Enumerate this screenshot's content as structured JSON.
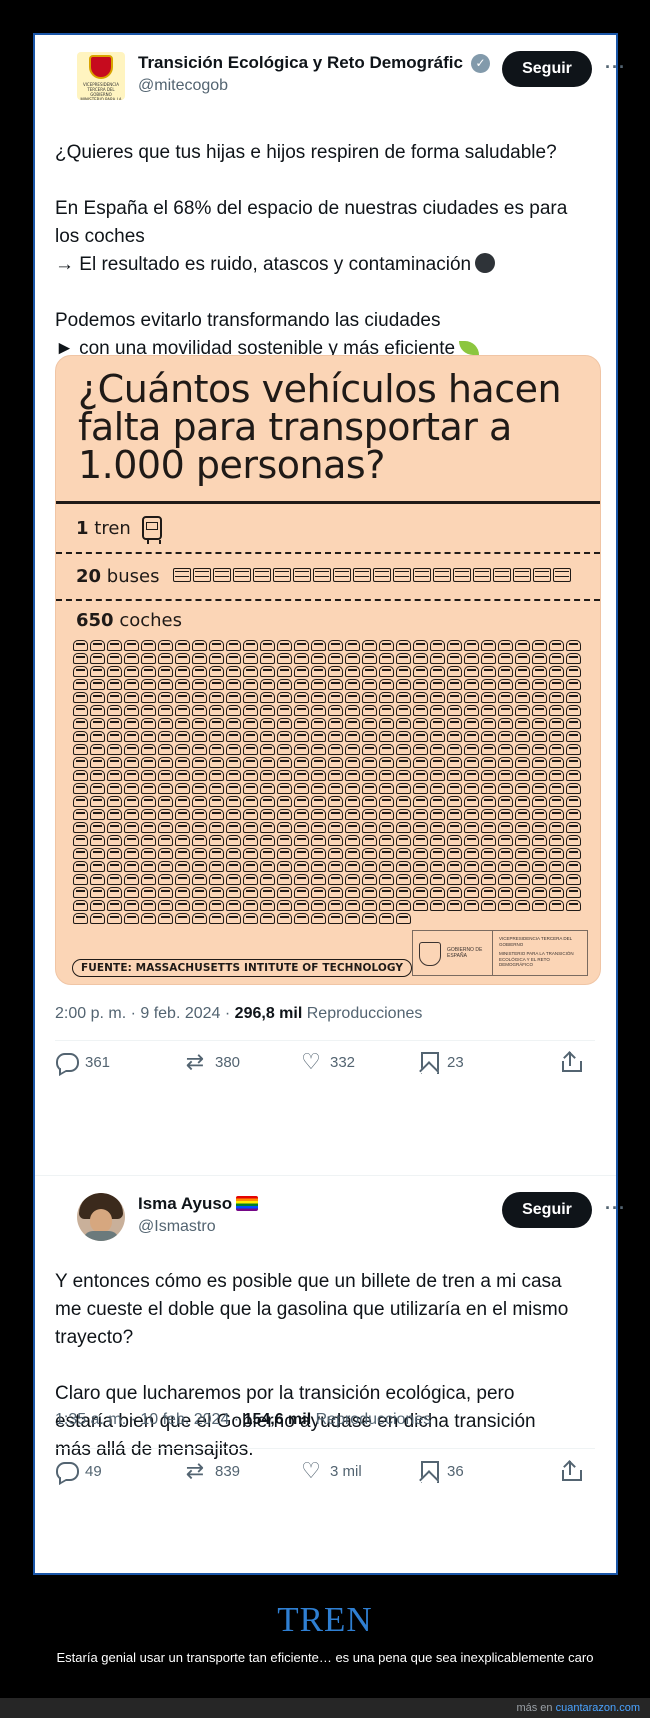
{
  "tweet1": {
    "name": "Transición Ecológica y Reto Demográfic",
    "handle": "@mitecogob",
    "avatar_text": "VICEPRESIDENCIA TERCERA DEL GOBIERNO MINISTERIO PARA LA TRANSICIÓN ECOLÓGICA Y EL RETO DEMOGRÁFICO",
    "follow_label": "Seguir",
    "more_label": "···",
    "verified_icon": "verified-badge-icon",
    "text_line1": "¿Quieres que tus hijas e hijos respiren de forma saludable?",
    "text_line2": "En España el 68% del espacio de nuestras ciudades es para",
    "text_line3": "los coches",
    "text_line4": "→ El resultado es ruido, atascos y contaminación",
    "text_line5": "Podemos evitarlo transformando las ciudades",
    "text_line6": "► con una movilidad sostenible y más eficiente",
    "infographic": {
      "title": "¿Cuántos vehículos hacen falta para transportar a 1.000 personas?",
      "train_count": "1",
      "train_label": "tren",
      "bus_count": "20",
      "bus_label": "buses",
      "bus_icons": 20,
      "car_count": "650",
      "car_label": "coches",
      "car_icons": 650,
      "source": "FUENTE: MASSACHUSETTS INTITUTE OF TECHNOLOGY",
      "gov_a": "GOBIERNO DE ESPAÑA",
      "gov_b1": "VICEPRESIDENCIA TERCERA DEL GOBIERNO",
      "gov_b2": "MINISTERIO PARA LA TRANSICIÓN ECOLÓGICA Y EL RETO DEMOGRÁFICO"
    },
    "time": "2:00 p. m. · 9 feb. 2024 ·",
    "views_count": "296,8 mil",
    "views_label": "Reproducciones",
    "replies": "361",
    "retweets": "380",
    "likes": "332",
    "bookmarks": "23"
  },
  "tweet2": {
    "name": "Isma Ayuso",
    "handle": "@Ismastro",
    "follow_label": "Seguir",
    "more_label": "···",
    "text_line1": "Y entonces cómo es posible que un billete de tren a mi casa",
    "text_line2": "me cueste el doble que la gasolina que utilizaría en el mismo",
    "text_line3": "trayecto?",
    "text_line4": "Claro que lucharemos por la transición ecológica, pero",
    "text_line5": "estaría bien que el Gobierno ayudase en dicha transición",
    "text_line6": "más allá de mensajitos.",
    "time": "1:35 a. m. · 10 feb. 2024 ·",
    "views_count": "154,6 mil",
    "views_label": "Reproducciones",
    "replies": "49",
    "retweets": "839",
    "likes": "3 mil",
    "bookmarks": "36"
  },
  "caption": {
    "title": "TREN",
    "text": "Estaría genial usar un transporte tan eficiente… es una pena que sea inexplicablemente caro"
  },
  "footer": {
    "prefix": "más en",
    "site": "cuantarazon.com"
  },
  "colors": {
    "frame": "#1a56a8",
    "caption_title": "#2f7fd2",
    "infographic_bg": "#fbd5b6"
  }
}
